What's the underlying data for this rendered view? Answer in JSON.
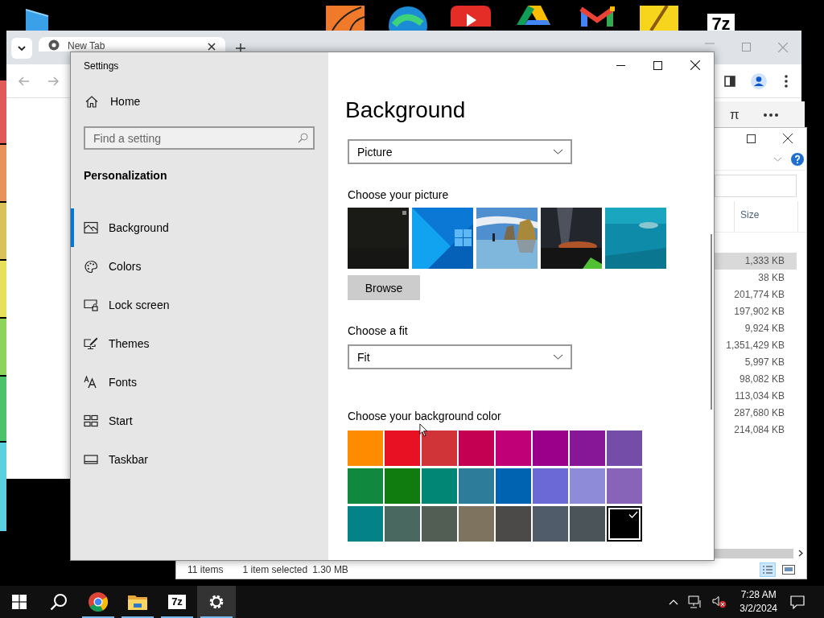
{
  "desktop": {
    "icons": [
      {
        "kind": "monitor"
      },
      {
        "kind": "ball"
      },
      {
        "kind": "swirl"
      },
      {
        "kind": "play"
      },
      {
        "kind": "triangle"
      },
      {
        "kind": "envelope"
      },
      {
        "kind": "pencil"
      },
      {
        "kind": "archive",
        "label": "7z"
      }
    ]
  },
  "browser": {
    "tabs": [
      {
        "label": "New Tab",
        "selected": true
      }
    ]
  },
  "calculator": {
    "keys": [
      "π"
    ]
  },
  "explorer": {
    "columns": [
      "Size"
    ],
    "rows": [
      {
        "size": "1,333 KB",
        "selected": true
      },
      {
        "size": "38 KB",
        "selected": false
      },
      {
        "size": "201,774 KB",
        "selected": false
      },
      {
        "size": "197,902 KB",
        "selected": false
      },
      {
        "size": "9,924 KB",
        "selected": false
      },
      {
        "size": "1,351,429 KB",
        "selected": false
      },
      {
        "size": "5,997 KB",
        "selected": false
      },
      {
        "size": "98,082 KB",
        "selected": false
      },
      {
        "size": "113,034 KB",
        "selected": false
      },
      {
        "size": "287,680 KB",
        "selected": false
      },
      {
        "size": "214,084 KB",
        "selected": false
      }
    ],
    "status": {
      "count": "11 items",
      "selection": "1 item selected",
      "size": "1.30 MB"
    }
  },
  "settings": {
    "title": "Settings",
    "home": "Home",
    "search": {
      "placeholder": "Find a setting"
    },
    "section": "Personalization",
    "nav": [
      {
        "label": "Background",
        "kind": "picture",
        "selected": true
      },
      {
        "label": "Colors",
        "kind": "palette",
        "selected": false
      },
      {
        "label": "Lock screen",
        "kind": "lock",
        "selected": false
      },
      {
        "label": "Themes",
        "kind": "themes",
        "selected": false
      },
      {
        "label": "Fonts",
        "kind": "fonts",
        "selected": false
      },
      {
        "label": "Start",
        "kind": "start",
        "selected": false
      },
      {
        "label": "Taskbar",
        "kind": "taskbar",
        "selected": false
      }
    ],
    "page": {
      "title": "Background",
      "background": {
        "value": "Picture"
      },
      "picture_label": "Choose your picture",
      "browse": "Browse",
      "fit_label": "Choose a fit",
      "fit": {
        "value": "Fit"
      },
      "color_label": "Choose your background color",
      "colors": [
        {
          "color": "#ff8c00",
          "selected": false
        },
        {
          "color": "#e81123",
          "selected": false
        },
        {
          "color": "#d13438",
          "selected": false
        },
        {
          "color": "#c30052",
          "selected": false
        },
        {
          "color": "#bf0077",
          "selected": false
        },
        {
          "color": "#9a0089",
          "selected": false
        },
        {
          "color": "#881798",
          "selected": false
        },
        {
          "color": "#744da9",
          "selected": false
        },
        {
          "color": "#10893e",
          "selected": false
        },
        {
          "color": "#107c10",
          "selected": false
        },
        {
          "color": "#018574",
          "selected": false
        },
        {
          "color": "#2d7d9a",
          "selected": false
        },
        {
          "color": "#0063b1",
          "selected": false
        },
        {
          "color": "#6b69d6",
          "selected": false
        },
        {
          "color": "#8e8cd8",
          "selected": false
        },
        {
          "color": "#8764b8",
          "selected": false
        },
        {
          "color": "#038387",
          "selected": false
        },
        {
          "color": "#486860",
          "selected": false
        },
        {
          "color": "#525e54",
          "selected": false
        },
        {
          "color": "#7e735f",
          "selected": false
        },
        {
          "color": "#4c4a48",
          "selected": false
        },
        {
          "color": "#515c6b",
          "selected": false
        },
        {
          "color": "#4a5459",
          "selected": false
        },
        {
          "color": "#000000",
          "selected": true
        }
      ]
    }
  },
  "taskbar": {
    "apps": [
      {
        "kind": "start",
        "open": false,
        "active": false
      },
      {
        "kind": "search",
        "open": false,
        "active": false
      },
      {
        "kind": "browser",
        "open": true,
        "active": false
      },
      {
        "kind": "folder",
        "open": true,
        "active": false
      },
      {
        "kind": "archive",
        "label": "7z",
        "open": true,
        "active": false
      },
      {
        "kind": "settings",
        "open": true,
        "active": true
      }
    ],
    "time": "7:28 AM",
    "date": "3/2/2024"
  }
}
